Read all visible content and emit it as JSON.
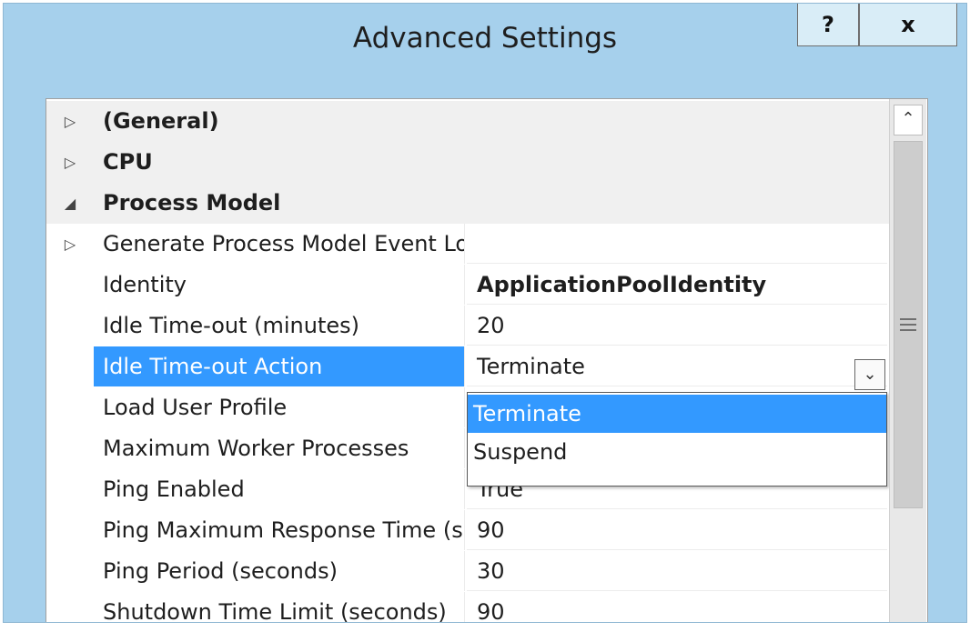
{
  "window": {
    "title": "Advanced Settings",
    "help_label": "?",
    "close_label": "x"
  },
  "categories": [
    {
      "label": "(General)",
      "expander": "▷"
    },
    {
      "label": "CPU",
      "expander": "▷"
    },
    {
      "label": "Process Model",
      "expander": "◢"
    }
  ],
  "properties": [
    {
      "label": "Generate Process Model Event Log Entry",
      "value": "",
      "expander": "▷"
    },
    {
      "label": "Identity",
      "value": "ApplicationPoolIdentity"
    },
    {
      "label": "Idle Time-out (minutes)",
      "value": "20"
    },
    {
      "label": "Idle Time-out Action",
      "value": "Terminate"
    },
    {
      "label": "Load User Profile",
      "value": ""
    },
    {
      "label": "Maximum Worker Processes",
      "value": ""
    },
    {
      "label": "Ping Enabled",
      "value": "True"
    },
    {
      "label": "Ping Maximum Response Time (seconds)",
      "value": "90"
    },
    {
      "label": "Ping Period (seconds)",
      "value": "30"
    },
    {
      "label": "Shutdown Time Limit (seconds)",
      "value": "90"
    }
  ],
  "dropdown": {
    "options": [
      "Terminate",
      "Suspend"
    ],
    "selected": "Terminate"
  },
  "icons": {
    "collapsed": "triangle-right-icon",
    "expanded": "triangle-down-right-icon",
    "combo": "chevron-down-icon",
    "scroll_up": "chevron-up-icon"
  },
  "colors": {
    "selection": "#3399ff",
    "window_frame": "#a6d0ec"
  }
}
